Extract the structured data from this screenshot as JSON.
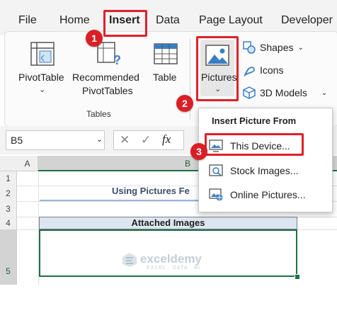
{
  "menu": {
    "tabs": [
      {
        "label": "File"
      },
      {
        "label": "Home"
      },
      {
        "label": "Insert"
      },
      {
        "label": "Data"
      },
      {
        "label": "Page Layout"
      },
      {
        "label": "Developer"
      }
    ],
    "active": "Insert"
  },
  "ribbon": {
    "tables_group": {
      "label": "Tables",
      "pivot_table": "PivotTable",
      "recommended_line1": "Recommended",
      "recommended_line2": "PivotTables",
      "table": "Table"
    },
    "pictures": "Pictures",
    "shapes": "Shapes",
    "icons": "Icons",
    "models_3d": "3D Models"
  },
  "formula_bar": {
    "name_box": "B5",
    "fx": "fx"
  },
  "grid": {
    "columns": [
      "A",
      "B"
    ],
    "rows": [
      "1",
      "2",
      "3",
      "4",
      "5"
    ],
    "title_text": "Using Pictures Fe",
    "table_header": "Attached Images",
    "watermark_name": "exceldemy",
    "watermark_tagline": "EXCEL · DATA · BI"
  },
  "dropdown": {
    "title": "Insert Picture From",
    "items": [
      {
        "label": "This Device..."
      },
      {
        "label": "Stock Images..."
      },
      {
        "label": "Online Pictures..."
      }
    ]
  },
  "badges": [
    "1",
    "2",
    "3"
  ],
  "colors": {
    "excel_green": "#1e7145",
    "highlight_red": "#e0202a",
    "badge_red": "#d92027",
    "header_band": "#dce6f1"
  }
}
